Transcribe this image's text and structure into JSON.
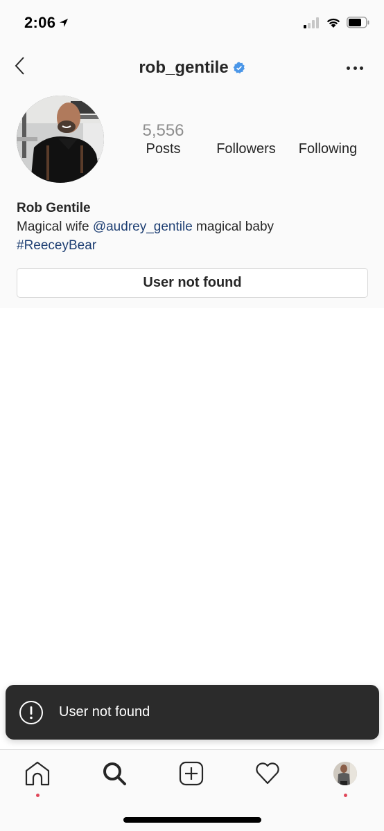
{
  "status_bar": {
    "time": "2:06",
    "location_icon": "location-arrow-icon",
    "signal_icon": "cellular-signal-icon",
    "wifi_icon": "wifi-icon",
    "battery_icon": "battery-icon"
  },
  "nav": {
    "back_icon": "chevron-left-icon",
    "username": "rob_gentile",
    "verified": true,
    "verified_color": "#4a96e8",
    "more_icon": "more-horizontal-icon"
  },
  "profile": {
    "avatar_icon": "profile-photo",
    "stats": {
      "posts": {
        "value": "5,556",
        "label": "Posts"
      },
      "followers": {
        "value": "",
        "label": "Followers"
      },
      "following": {
        "value": "",
        "label": "Following"
      }
    },
    "display_name": "Rob Gentile",
    "bio": {
      "part1": "Magical wife ",
      "mention": "@audrey_gentile",
      "part2": " magical baby",
      "hashtag": "#ReeceyBear",
      "link_color": "#1e3f73"
    },
    "action_button_label": "User not found"
  },
  "toast": {
    "icon": "alert-circle-icon",
    "message": "User not found"
  },
  "tab_bar": {
    "items": [
      {
        "name": "home",
        "icon": "home-icon",
        "badge_dot": true
      },
      {
        "name": "search",
        "icon": "search-icon",
        "badge_dot": false
      },
      {
        "name": "new-post",
        "icon": "plus-square-icon",
        "badge_dot": false
      },
      {
        "name": "activity",
        "icon": "heart-icon",
        "badge_dot": false
      },
      {
        "name": "profile",
        "icon": "profile-avatar",
        "badge_dot": true
      }
    ],
    "badge_color": "#e0475a"
  }
}
